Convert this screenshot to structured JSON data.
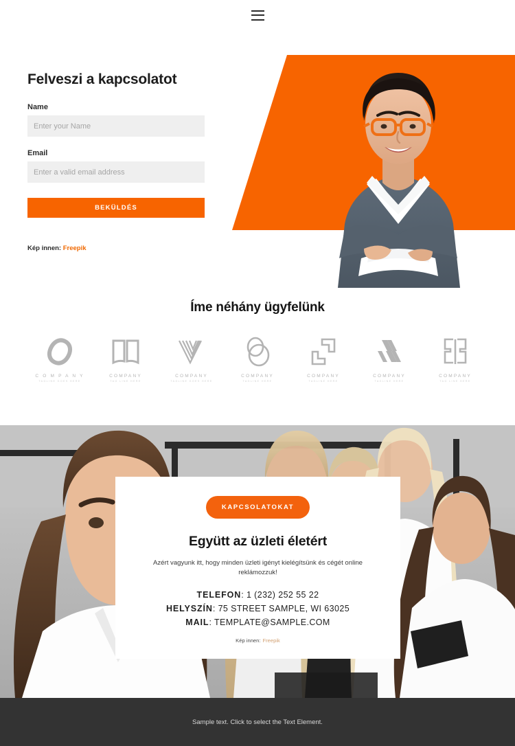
{
  "header": {
    "menu_icon": "hamburger-menu-icon"
  },
  "hero": {
    "title": "Felveszi a kapcsolatot",
    "fields": [
      {
        "label": "Name",
        "placeholder": "Enter your Name",
        "value": ""
      },
      {
        "label": "Email",
        "placeholder": "Enter a valid email address",
        "value": ""
      }
    ],
    "submit_label": "BEKÜLDÉS",
    "credit_prefix": "Kép innen:",
    "credit_link": "Freepik",
    "shape_color": "#f76400",
    "photo_alt": "smiling businesswoman with orange glasses, arms crossed"
  },
  "clients": {
    "title": "Íme néhány ügyfelünk",
    "logos": [
      {
        "mark": "logo-mark-oval",
        "name": "C O M P A N Y",
        "tagline": "TAGLINE GOES HERE"
      },
      {
        "mark": "logo-mark-book",
        "name": "COMPANY",
        "tagline": "TAG LINE HERE"
      },
      {
        "mark": "logo-mark-chevron",
        "name": "COMPANY",
        "tagline": "TAGLINE GOES HERE"
      },
      {
        "mark": "logo-mark-circles",
        "name": "COMPANY",
        "tagline": "TAGLINE HERE"
      },
      {
        "mark": "logo-mark-brackets",
        "name": "COMPANY",
        "tagline": "TAGLINE HERE"
      },
      {
        "mark": "logo-mark-stripes",
        "name": "COMPANY",
        "tagline": "TAGLINE HERE"
      },
      {
        "mark": "logo-mark-blocks",
        "name": "COMPANY",
        "tagline": "TAG LINE HERE"
      }
    ],
    "logo_color": "#b4b4b4"
  },
  "contact": {
    "pill_label": "KAPCSOLATOKAT",
    "title": "Együtt az üzleti életért",
    "subtitle": "Azért vagyunk itt, hogy minden üzleti igényt kielégítsünk és cégét online reklámozzuk!",
    "details": [
      {
        "label": "TELEFON",
        "sep": ": ",
        "value": "1 (232) 252 55 22"
      },
      {
        "label": "HELYSZÍN",
        "sep": ": ",
        "value": "75 STREET SAMPLE, WI 63025"
      },
      {
        "label": "MAIL",
        "sep": ": ",
        "value": "TEMPLATE@SAMPLE.COM"
      }
    ],
    "credit_prefix": "Kép innen:",
    "credit_link": "Freepik",
    "background_alt": "group of businesswomen in office"
  },
  "footer": {
    "text": "Sample text. Click to select the Text Element.",
    "background": "#333333"
  }
}
